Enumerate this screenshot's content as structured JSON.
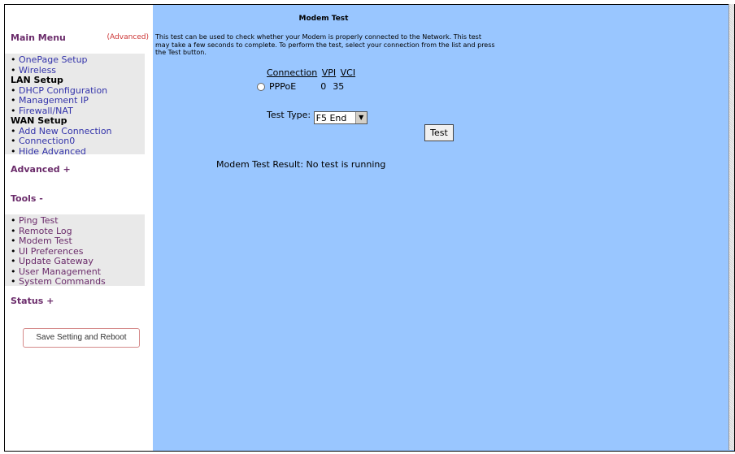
{
  "sidebar": {
    "main_menu_title": "Main Menu",
    "advanced_link": "(Advanced)",
    "main_items": [
      {
        "type": "item",
        "label": "OnePage Setup"
      },
      {
        "type": "item",
        "label": "Wireless"
      },
      {
        "type": "header",
        "label": "LAN Setup"
      },
      {
        "type": "item",
        "label": "DHCP Configuration"
      },
      {
        "type": "item",
        "label": "Management IP"
      },
      {
        "type": "item",
        "label": "Firewall/NAT"
      },
      {
        "type": "header",
        "label": "WAN Setup"
      },
      {
        "type": "item",
        "label": "Add New Connection"
      },
      {
        "type": "item",
        "label": "Connection0"
      },
      {
        "type": "item",
        "label": "Hide Advanced"
      }
    ],
    "advanced_section": "Advanced +",
    "tools_section": "Tools -",
    "tools_items": [
      "Ping Test",
      "Remote Log",
      "Modem Test",
      "UI Preferences",
      "Update Gateway",
      "User Management",
      "System Commands"
    ],
    "status_section": "Status +",
    "reboot_button": "Save Setting and Reboot"
  },
  "main": {
    "title": "Modem Test",
    "description": "This test can be used to check whether your Modem is properly connected to the Network. This test may take a few seconds to complete. To perform the test, select your connection from the list and press the Test button.",
    "table_headers": {
      "connection": "Connection",
      "vpi": "VPI",
      "vci": "VCI"
    },
    "connection_row": {
      "name": "PPPoE",
      "vpi": "0",
      "vci": "35"
    },
    "test_type_label": "Test Type:",
    "test_type_value": "F5 End",
    "test_button": "Test",
    "result_label": "Modem Test Result:",
    "result_value": "No test is running"
  },
  "colors": {
    "content_bg": "#99c6ff",
    "menu_bg": "#e9e9e9",
    "link": "#3333aa",
    "section": "#6b2c6b"
  }
}
